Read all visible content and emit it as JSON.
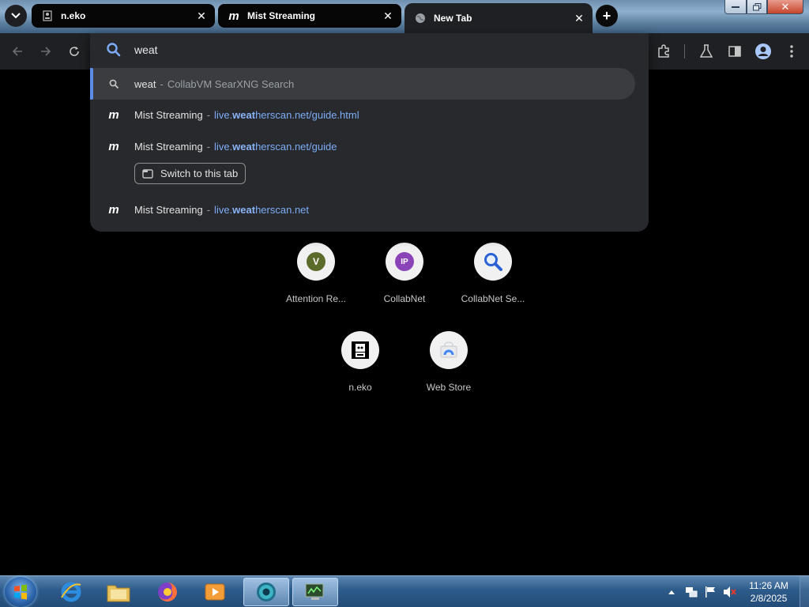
{
  "tabs": [
    {
      "label": "n.eko",
      "icon": "neko-favicon-icon"
    },
    {
      "label": "Mist Streaming",
      "icon": "mist-favicon-icon"
    },
    {
      "label": "New Tab",
      "icon": "globe-favicon-icon",
      "active": true
    }
  ],
  "tab_close": "✕",
  "new_tab": "+",
  "omnibox": {
    "query": "weat",
    "suggestions": [
      {
        "title": "weat",
        "sep": "-",
        "detail": "CollabVM SearXNG Search",
        "type": "search"
      },
      {
        "title": "Mist Streaming",
        "sep": "-",
        "url_prefix": "live.",
        "url_match": "weat",
        "url_suffix": "herscan.net/guide.html",
        "type": "history"
      },
      {
        "title": "Mist Streaming",
        "sep": "-",
        "url_prefix": "live.",
        "url_match": "weat",
        "url_suffix": "herscan.net/guide",
        "type": "open-tab"
      },
      {
        "title": "Mist Streaming",
        "sep": "-",
        "url_prefix": "live.",
        "url_match": "weat",
        "url_suffix": "herscan.net",
        "type": "history"
      }
    ],
    "switch_tab_label": "Switch to this tab"
  },
  "shortcuts": [
    {
      "name": "Attention Re...",
      "letter": "V",
      "color": "#5b6b2a"
    },
    {
      "name": "CollabNet",
      "letter": "IP",
      "color": "#8a44b8"
    },
    {
      "name": "CollabNet Se...",
      "icon": "search-icon"
    },
    {
      "name": "n.eko",
      "icon": "neko-icon"
    },
    {
      "name": "Web Store",
      "icon": "webstore-icon"
    }
  ],
  "clock": {
    "time": "11:26 AM",
    "date": "2/8/2025"
  },
  "window_controls": {
    "close": "✕"
  },
  "colors": {
    "accent": "#8ab4f8",
    "tab_bg": "#1f2023",
    "dropdown_bg": "#28292c"
  }
}
